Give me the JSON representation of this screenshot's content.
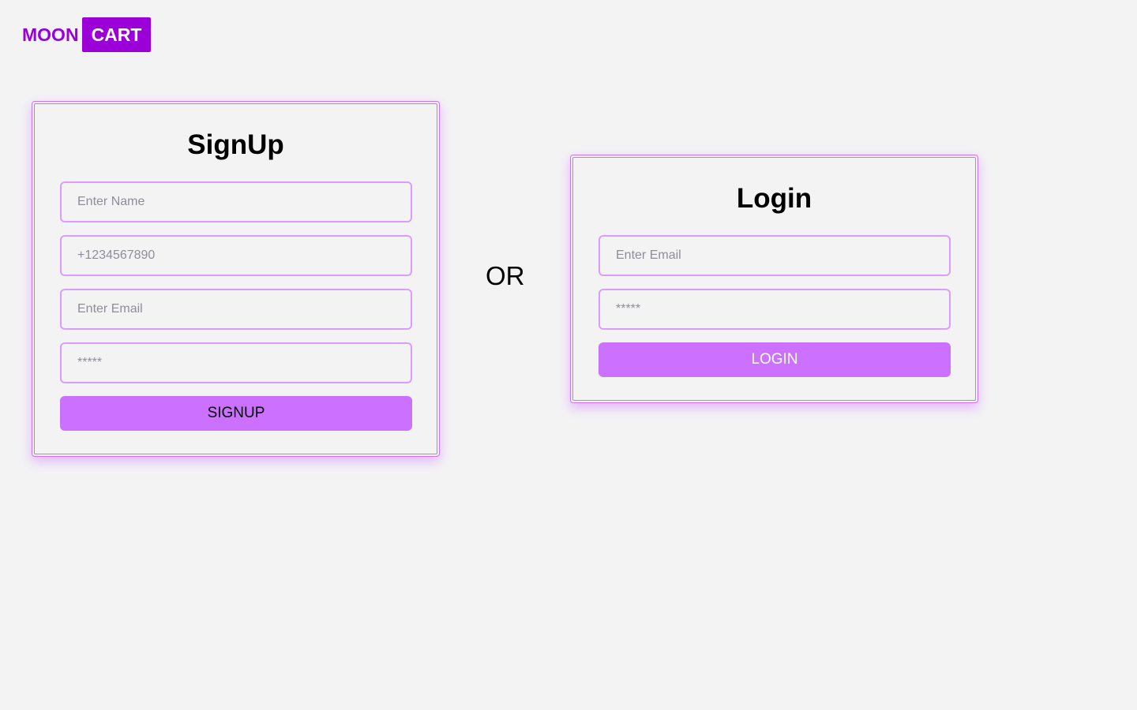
{
  "logo": {
    "part1": "MOON",
    "part2": "CART"
  },
  "signup": {
    "title": "SignUp",
    "name_placeholder": "Enter Name",
    "phone_placeholder": "+1234567890",
    "email_placeholder": "Enter Email",
    "password_placeholder": "*****",
    "button_label": "SIGNUP"
  },
  "divider": {
    "label": "OR"
  },
  "login": {
    "title": "Login",
    "email_placeholder": "Enter Email",
    "password_placeholder": "*****",
    "button_label": "LOGIN"
  },
  "colors": {
    "brand": "#9b00d9",
    "accent": "#cc70ff",
    "field_border": "#dc9cff",
    "background": "#f3f3f4"
  }
}
